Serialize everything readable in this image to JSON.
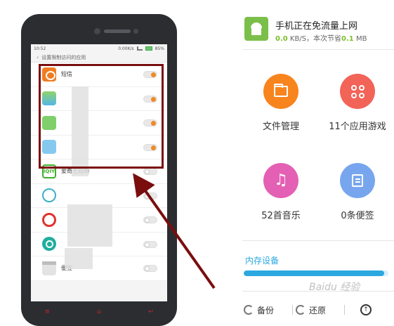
{
  "phone": {
    "status_time": "10:52",
    "status_speed": "0.00K/s",
    "status_battery": "85%",
    "header_title": "设置限制访问的应用",
    "apps": [
      {
        "name": "短信",
        "icon": "message-icon",
        "toggle": "on"
      },
      {
        "name": "",
        "icon": "gallery-icon",
        "toggle": "on"
      },
      {
        "name": "",
        "icon": "app-icon-green",
        "toggle": "on"
      },
      {
        "name": "",
        "icon": "app-icon-blue",
        "toggle": "on"
      },
      {
        "name": "爱奇艺视频",
        "icon": "iqiyi-icon",
        "toggle": "off"
      },
      {
        "name": "",
        "icon": "browser-icon",
        "toggle": "off"
      },
      {
        "name": "",
        "icon": "weibo-icon",
        "toggle": "off"
      },
      {
        "name": "",
        "icon": "camera-icon",
        "toggle": "off"
      },
      {
        "name": "便签",
        "icon": "notes-icon",
        "toggle": "off"
      }
    ],
    "iqiyi_logo_text": "iQIY",
    "nav": [
      "≡",
      "⌂",
      "↩"
    ]
  },
  "panel": {
    "title": "手机正在免流量上网",
    "speed_value": "0.0",
    "speed_unit": "KB/S，本次节省",
    "saved_value": "0.1",
    "saved_unit": "MB",
    "tiles": [
      {
        "label": "文件管理",
        "color": "#f8841e",
        "icon": "folder-icon"
      },
      {
        "label": "11个应用游戏",
        "color": "#f26358",
        "icon": "apps-grid-icon"
      },
      {
        "label": "52首音乐",
        "color": "#e460b4",
        "icon": "music-icon"
      },
      {
        "label": "0条便签",
        "color": "#77a6ef",
        "icon": "note-icon"
      }
    ],
    "music_glyph": "♫",
    "memory_label": "内存设备",
    "memory_used": 0.97,
    "footer": {
      "backup": "备份",
      "restore": "还原"
    }
  },
  "watermark": "Baidu 经验",
  "colors": {
    "highlight": "#7a0e0e",
    "toggle_on": "#f08a24",
    "accent_blue": "#2ba8e0"
  }
}
